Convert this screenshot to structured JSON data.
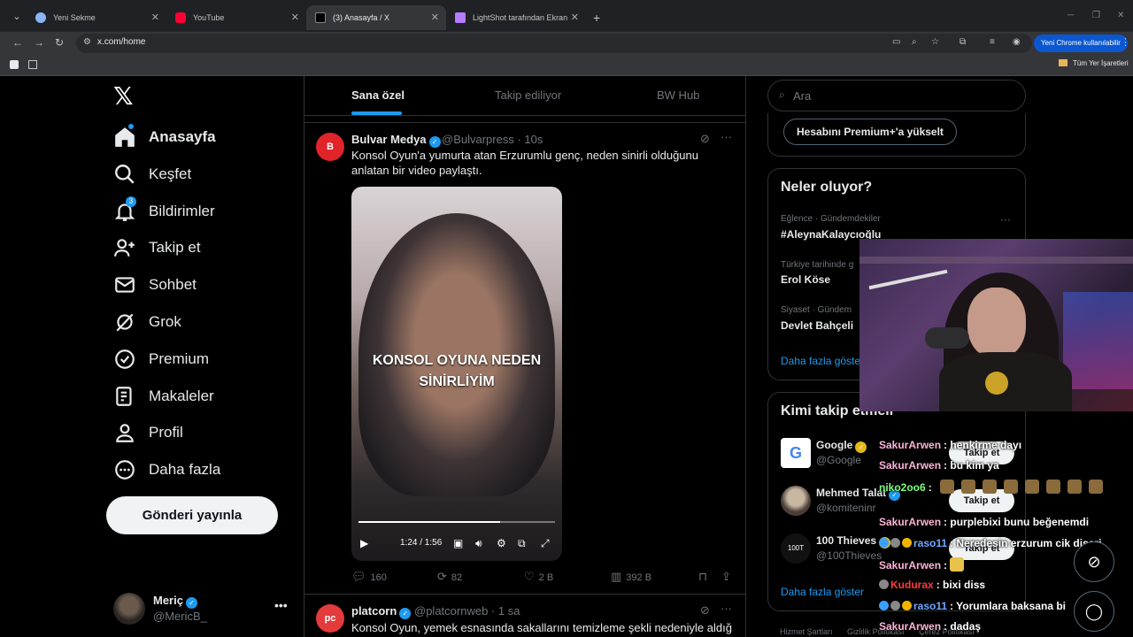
{
  "browser": {
    "tabs": [
      {
        "title": "Yeni Sekme",
        "active": false
      },
      {
        "title": "YouTube",
        "active": false
      },
      {
        "title": "(3) Anasayfa / X",
        "active": true
      },
      {
        "title": "LightShot tarafından Ekran Görü",
        "active": false
      }
    ],
    "url": "x.com/home",
    "chrome_pill": "Yeni Chrome kullanılabilir",
    "bookmarks_label": "Tüm Yer İşaretleri"
  },
  "nav": {
    "items": [
      {
        "label": "Anasayfa",
        "icon": "home-icon"
      },
      {
        "label": "Keşfet",
        "icon": "search-icon"
      },
      {
        "label": "Bildirimler",
        "icon": "bell-icon",
        "badge": "3"
      },
      {
        "label": "Takip et",
        "icon": "add-user-icon"
      },
      {
        "label": "Sohbet",
        "icon": "mail-icon"
      },
      {
        "label": "Grok",
        "icon": "grok-icon"
      },
      {
        "label": "Premium",
        "icon": "premium-icon"
      },
      {
        "label": "Makaleler",
        "icon": "articles-icon"
      },
      {
        "label": "Profil",
        "icon": "person-icon"
      },
      {
        "label": "Daha fazla",
        "icon": "more-circle-icon"
      }
    ],
    "post_button": "Gönderi yayınla",
    "account": {
      "name": "Meriç",
      "handle": "@MericB_"
    }
  },
  "timeline": {
    "tabs": [
      "Sana özel",
      "Takip ediliyor",
      "BW Hub"
    ],
    "tweets": [
      {
        "name": "Bulvar Medya",
        "handle": "@Bulvarpress",
        "time": "· 10s",
        "text": "Konsol Oyun'a yumurta atan Erzurumlu genç, neden sinirli olduğunu anlatan bir video paylaştı.",
        "video": {
          "caption_line1": "KONSOL OYUNA NEDEN",
          "caption_line2": "SİNİRLİYİM",
          "time": "1:24 / 1:56",
          "progress": 0.72
        },
        "stats": {
          "replies": "160",
          "reposts": "82",
          "likes": "2 B",
          "views": "392 B"
        }
      },
      {
        "name": "platcorn",
        "handle": "@platcornweb",
        "time": "· 1 sa",
        "text": "Konsol Oyun, yemek esnasında sakallarını temizleme şekli nedeniyle aldığı"
      }
    ]
  },
  "sidebar": {
    "search_placeholder": "Ara",
    "premium_button": "Hesabını Premium+'a yükselt",
    "trends_title": "Neler oluyor?",
    "trends": [
      {
        "meta": "Eğlence · Gündemdekiler",
        "name": "#AleynaKalaycıoğlu"
      },
      {
        "meta": "Türkiye tarihinde g",
        "name": "Erol Köse"
      },
      {
        "meta": "Siyaset · Gündem",
        "name": "Devlet Bahçeli"
      }
    ],
    "trends_more": "Daha fazla göste",
    "who_title": "Kimi takip etmeli",
    "who": [
      {
        "name": "Google",
        "handle": "@Google",
        "follow": "Takip et"
      },
      {
        "name": "Mehmed Talat",
        "handle": "@komiteninr",
        "follow": "Takip et"
      },
      {
        "name": "100 Thieves",
        "handle": "@100Thieves",
        "follow": "Takip et"
      }
    ],
    "who_more": "Daha fazla göster",
    "footer": [
      "Hizmet Şartları",
      "Gizlilik Politikası",
      "Çerez Politikası"
    ]
  },
  "chat": {
    "messages": [
      {
        "user": "SakurArwen",
        "text": ": henkirme dayı",
        "color": "#ffb3d9"
      },
      {
        "user": "SakurArwen",
        "text": ": bu kim ya",
        "color": "#ffb3d9"
      },
      {
        "user": "niko2oo6",
        "text": ":",
        "color": "#7cff7c"
      },
      {
        "user": "SakurArwen",
        "text": ": purplebixi bunu beğenemdi",
        "color": "#ffb3d9"
      },
      {
        "user": "raso11",
        "text": ": Neredesin erzurum cik disari",
        "color": "#6ea8ff"
      },
      {
        "user": "SakurArwen",
        "text": ":",
        "color": "#ffb3d9"
      },
      {
        "user": "Kudurax",
        "text": ": bixi diss",
        "color": "#ff3b3b"
      },
      {
        "user": "raso11",
        "text": ": Yorumlara baksana bi",
        "color": "#6ea8ff"
      },
      {
        "user": "SakurArwen",
        "text": ": dadaş",
        "color": "#ffb3d9"
      }
    ]
  },
  "colors": {
    "accent": "#1d9bf0",
    "background": "#000000",
    "border": "#2f3336"
  }
}
